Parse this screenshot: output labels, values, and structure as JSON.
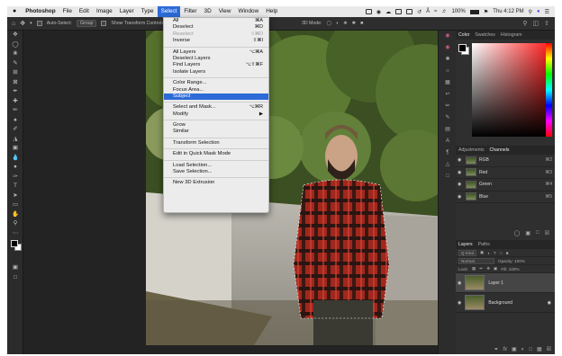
{
  "menubar": {
    "apple": "",
    "items": [
      "Photoshop",
      "File",
      "Edit",
      "Image",
      "Layer",
      "Type",
      "Select",
      "Filter",
      "3D",
      "View",
      "Window",
      "Help"
    ],
    "active_index": 6,
    "battery": "100%",
    "clock": "Thu 4:12 PM"
  },
  "options": {
    "auto_select": "Auto-Select:",
    "group": "Group",
    "transform": "Show Transform Controls",
    "mode3d": "3D Mode:"
  },
  "select_menu": {
    "items": [
      {
        "label": "All",
        "shortcut": "⌘A"
      },
      {
        "label": "Deselect",
        "shortcut": "⌘D"
      },
      {
        "label": "Reselect",
        "shortcut": "⇧⌘D",
        "disabled": true
      },
      {
        "label": "Inverse",
        "shortcut": "⇧⌘I"
      },
      {
        "sep": true
      },
      {
        "label": "All Layers",
        "shortcut": "⌥⌘A"
      },
      {
        "label": "Deselect Layers",
        "shortcut": ""
      },
      {
        "label": "Find Layers",
        "shortcut": "⌥⇧⌘F"
      },
      {
        "label": "Isolate Layers",
        "shortcut": ""
      },
      {
        "sep": true
      },
      {
        "label": "Color Range...",
        "shortcut": ""
      },
      {
        "label": "Focus Area...",
        "shortcut": ""
      },
      {
        "label": "Subject",
        "shortcut": "",
        "highlighted": true
      },
      {
        "sep": true
      },
      {
        "label": "Select and Mask...",
        "shortcut": "⌥⌘R"
      },
      {
        "label": "Modify",
        "shortcut": "▶"
      },
      {
        "sep": true
      },
      {
        "label": "Grow",
        "shortcut": ""
      },
      {
        "label": "Similar",
        "shortcut": ""
      },
      {
        "sep": true
      },
      {
        "label": "Transform Selection",
        "shortcut": ""
      },
      {
        "sep": true
      },
      {
        "label": "Edit in Quick Mask Mode",
        "shortcut": ""
      },
      {
        "sep": true
      },
      {
        "label": "Load Selection...",
        "shortcut": ""
      },
      {
        "label": "Save Selection...",
        "shortcut": ""
      },
      {
        "sep": true
      },
      {
        "label": "New 3D Extrusion",
        "shortcut": ""
      }
    ]
  },
  "color_panel": {
    "tabs": [
      "Color",
      "Swatches",
      "Histogram"
    ]
  },
  "channels_panel": {
    "tabs": [
      "Adjustments",
      "Channels"
    ],
    "rows": [
      {
        "name": "RGB",
        "shortcut": "⌘2"
      },
      {
        "name": "Red",
        "shortcut": "⌘3"
      },
      {
        "name": "Green",
        "shortcut": "⌘4"
      },
      {
        "name": "Blue",
        "shortcut": "⌘5"
      }
    ]
  },
  "layers_panel": {
    "tabs": [
      "Layers",
      "Paths"
    ],
    "kind": "Q Kind",
    "blend": "Normal",
    "opacity": "Opacity: 100%",
    "lock": "Lock:",
    "fill": "Fill: 100%",
    "layers": [
      {
        "name": "Layer 1",
        "selected": true
      },
      {
        "name": "Background",
        "selected": false
      }
    ]
  },
  "colors": {
    "menu_highlight": "#2c6bd7",
    "panel_bg": "#2f2f2f",
    "app_bg": "#232323"
  }
}
